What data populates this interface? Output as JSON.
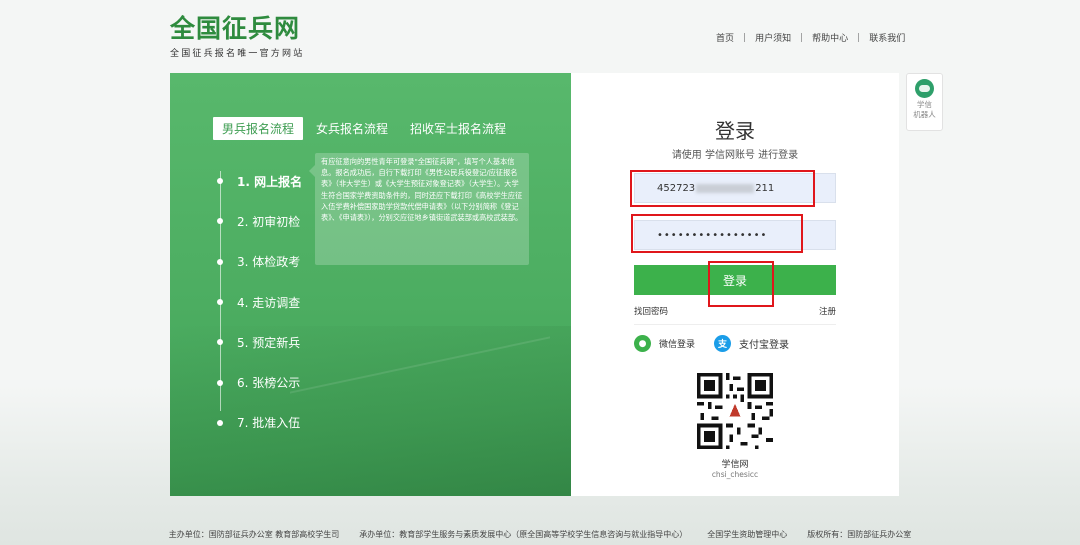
{
  "header": {
    "logo_title": "全国征兵网",
    "logo_subtitle": "全国征兵报名唯一官方网站",
    "nav": [
      "首页",
      "用户须知",
      "帮助中心",
      "联系我们"
    ]
  },
  "process": {
    "tabs": [
      "男兵报名流程",
      "女兵报名流程",
      "招收军士报名流程"
    ],
    "active_tab": 0,
    "steps": [
      "1. 网上报名",
      "2. 初审初检",
      "3. 体检政考",
      "4. 走访调查",
      "5. 预定新兵",
      "6. 张榜公示",
      "7. 批准入伍"
    ],
    "active_step": 0,
    "tip_text": "有应征意向的男性青年可登录\"全国征兵网\"，填写个人基本信息。报名成功后，自行下载打印《男性公民兵役登记/应征报名表》（非大学生）或《大学生预征对象登记表》（大学生）。大学生符合国家学费资助条件的，同时还应下载打印《高校学生应征入伍学费补偿国家助学贷款代偿申请表》（以下分别简称《登记表》、《申请表》），分别交应征地乡镇街道武装部或高校武装部。"
  },
  "login": {
    "title": "登录",
    "subtitle": "请使用 学信网账号 进行登录",
    "username_prefix": "452723",
    "username_suffix": "211",
    "password_mask": "••••••••••••••••",
    "submit_label": "登录",
    "forgot_label": "找回密码",
    "register_label": "注册",
    "wechat_label": "微信登录",
    "alipay_label": "支付宝登录",
    "qr_label": "学信网",
    "qr_sub": "chsi_chesicc"
  },
  "robot": {
    "line1": "学信",
    "line2": "机器人"
  },
  "footer": [
    "主办单位：国防部征兵办公室  教育部高校学生司",
    "承办单位：教育部学生服务与素质发展中心（原全国高等学校学生信息咨询与就业指导中心）",
    "全国学生资助管理中心",
    "版权所有：国防部征兵办公室"
  ],
  "colors": {
    "brand_green": "#3cb14b",
    "panel_green": "#4cad61",
    "highlight_red": "#e0161b",
    "input_bg": "#e9effb"
  }
}
